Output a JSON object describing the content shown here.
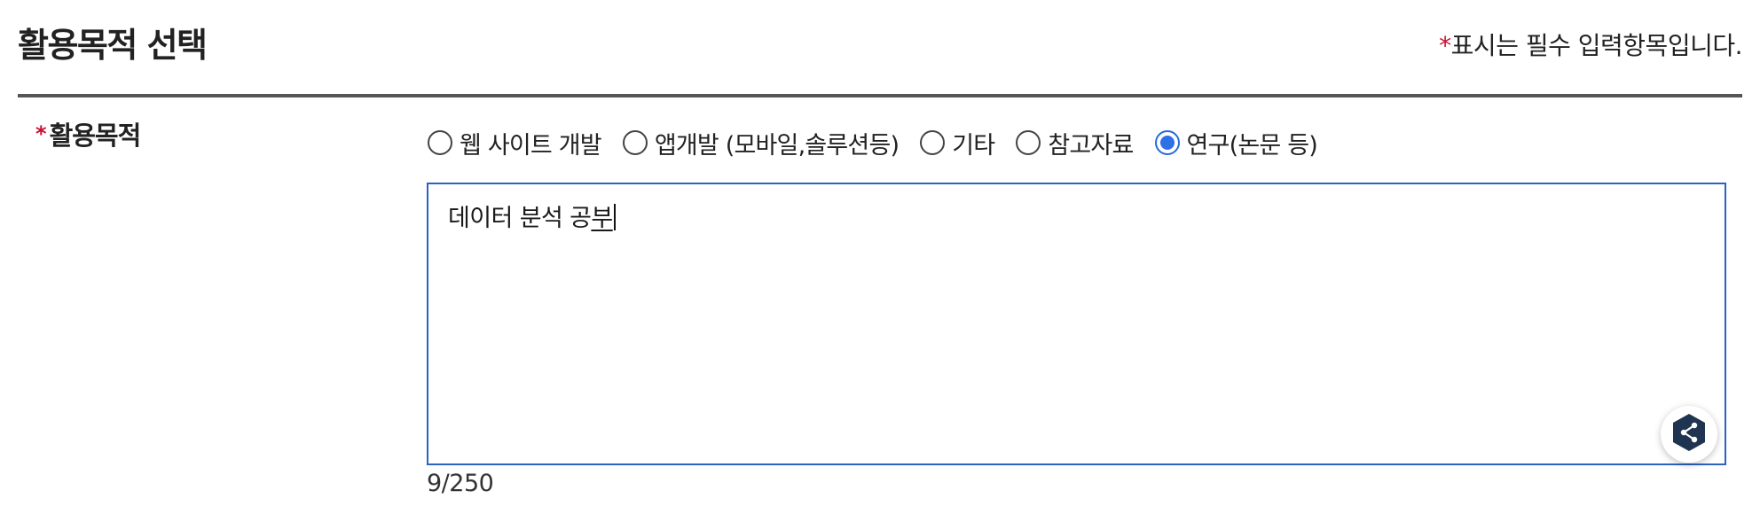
{
  "header": {
    "title": "활용목적 선택",
    "required_star": "*",
    "required_note": "표시는 필수 입력항목입니다."
  },
  "field": {
    "required_star": "*",
    "label": "활용목적"
  },
  "radios": {
    "options": [
      {
        "label": "웹 사이트 개발",
        "checked": false
      },
      {
        "label": "앱개발 (모바일,솔루션등)",
        "checked": false
      },
      {
        "label": "기타",
        "checked": false
      },
      {
        "label": "참고자료",
        "checked": false
      },
      {
        "label": "연구(논문 등)",
        "checked": true
      }
    ]
  },
  "textarea": {
    "value_committed": "데이터 분석 공",
    "value_composing": "부"
  },
  "counter": {
    "text": "9/250"
  },
  "widget": {
    "icon": "share-nodes-icon"
  },
  "colors": {
    "accent": "#2e70e6",
    "required": "#c8102e",
    "divider": "#555555",
    "widget_hex": "#1f3450"
  }
}
